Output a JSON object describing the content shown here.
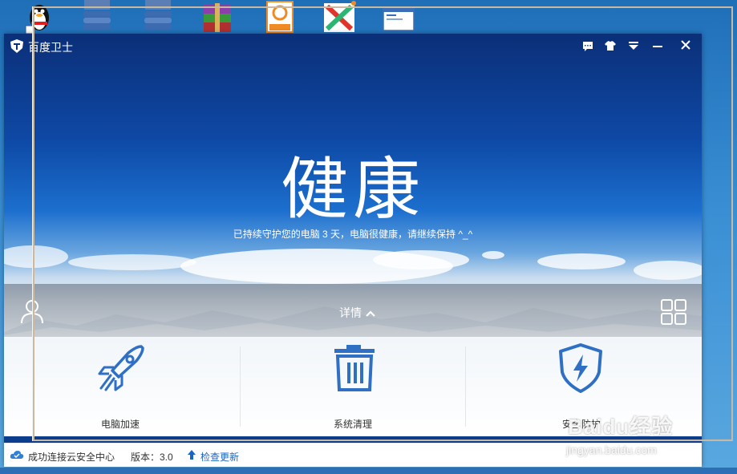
{
  "desktop_icons": [
    {
      "name": "qq-penguin-icon"
    },
    {
      "name": "caj-document-icon"
    },
    {
      "name": "caj-document-icon"
    },
    {
      "name": "winrar-archive-icon"
    },
    {
      "name": "foxit-pdf-icon"
    },
    {
      "name": "xmind-app-icon"
    },
    {
      "name": "window-thumbnail-icon"
    }
  ],
  "window": {
    "title": "百度卫士",
    "titlebar_buttons": [
      "feedback-icon",
      "skin-icon",
      "menu-icon",
      "minimize-icon",
      "close-icon"
    ]
  },
  "hero": {
    "status": "健康",
    "message": "已持续守护您的电脑 3 天，电脑很健康，请继续保持 ^_^",
    "details_label": "详情"
  },
  "features": [
    {
      "label": "电脑加速",
      "icon": "rocket-icon"
    },
    {
      "label": "系统清理",
      "icon": "trash-icon"
    },
    {
      "label": "安全防护",
      "icon": "lightning-shield-icon"
    }
  ],
  "footer": {
    "connection": "成功连接云安全中心",
    "version": "版本：3.0",
    "update_label": "检查更新"
  },
  "watermark": {
    "main": "Baidu经验",
    "sub": "jingyan.baidu.com"
  },
  "colors": {
    "accent": "#1a64c4",
    "icon_blue": "#2f6fc4",
    "hero_top": "#0b2f78"
  }
}
